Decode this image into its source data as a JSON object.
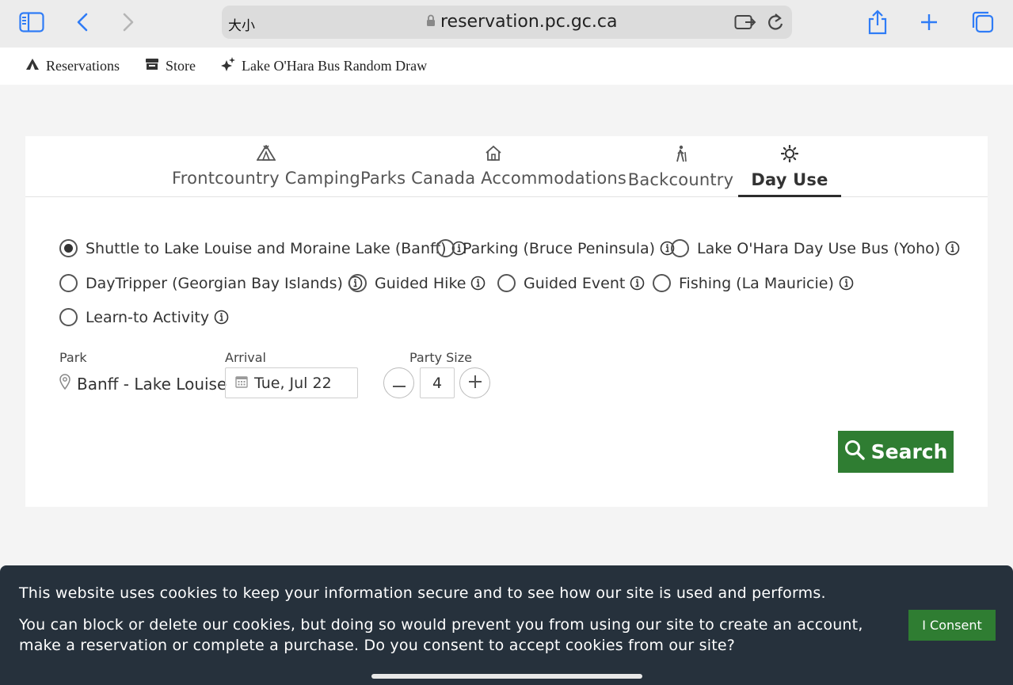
{
  "browser": {
    "text_size_label": "大小",
    "domain": "reservation.pc.gc.ca",
    "icons": [
      "sidebar-icon",
      "back-icon",
      "forward-icon",
      "lock-icon",
      "extension-icon",
      "reload-icon",
      "share-icon",
      "new-tab-icon",
      "tabs-icon"
    ]
  },
  "site_nav": {
    "items": [
      {
        "label": "Reservations",
        "icon": "tent-icon"
      },
      {
        "label": "Store",
        "icon": "store-icon"
      },
      {
        "label": "Lake O'Hara Bus Random Draw",
        "icon": "sparkle-icon"
      }
    ]
  },
  "tabs": [
    {
      "label": "Frontcountry Camping",
      "icon": "tent-icon",
      "active": false
    },
    {
      "label": "Parks Canada Accommodations",
      "icon": "house-icon",
      "active": false
    },
    {
      "label": "Backcountry",
      "icon": "hiker-icon",
      "active": false
    },
    {
      "label": "Day Use",
      "icon": "sun-icon",
      "active": true
    }
  ],
  "booking_types": [
    {
      "label": "Shuttle to Lake Louise and Moraine Lake (Banff)",
      "checked": true
    },
    {
      "label": "Parking (Bruce Peninsula)",
      "checked": false
    },
    {
      "label": "Lake O'Hara Day Use Bus (Yoho)",
      "checked": false
    },
    {
      "label": "DayTripper (Georgian Bay Islands)",
      "checked": false
    },
    {
      "label": "Guided Hike",
      "checked": false
    },
    {
      "label": "Guided Event",
      "checked": false
    },
    {
      "label": "Fishing (La Mauricie)",
      "checked": false
    },
    {
      "label": "Learn-to Activity",
      "checked": false
    }
  ],
  "form": {
    "park_label": "Park",
    "park_value": "Banff - Lake Louise",
    "arrival_label": "Arrival",
    "arrival_value": "Tue, Jul 22",
    "party_label": "Party Size",
    "party_value": "4",
    "search_label": "Search"
  },
  "cookie_banner": {
    "line1": "This website uses cookies to keep your information secure and to see how our site is used and performs.",
    "line2": "You can block or delete our cookies, but doing so would prevent you from using our site to create an account, make a reservation or complete a purchase. Do you consent to accept cookies from our site?",
    "consent_label": "I Consent"
  },
  "colors": {
    "accent_green": "#2f7d32",
    "banner_bg": "#26313c",
    "browser_blue": "#2f7cf6"
  }
}
